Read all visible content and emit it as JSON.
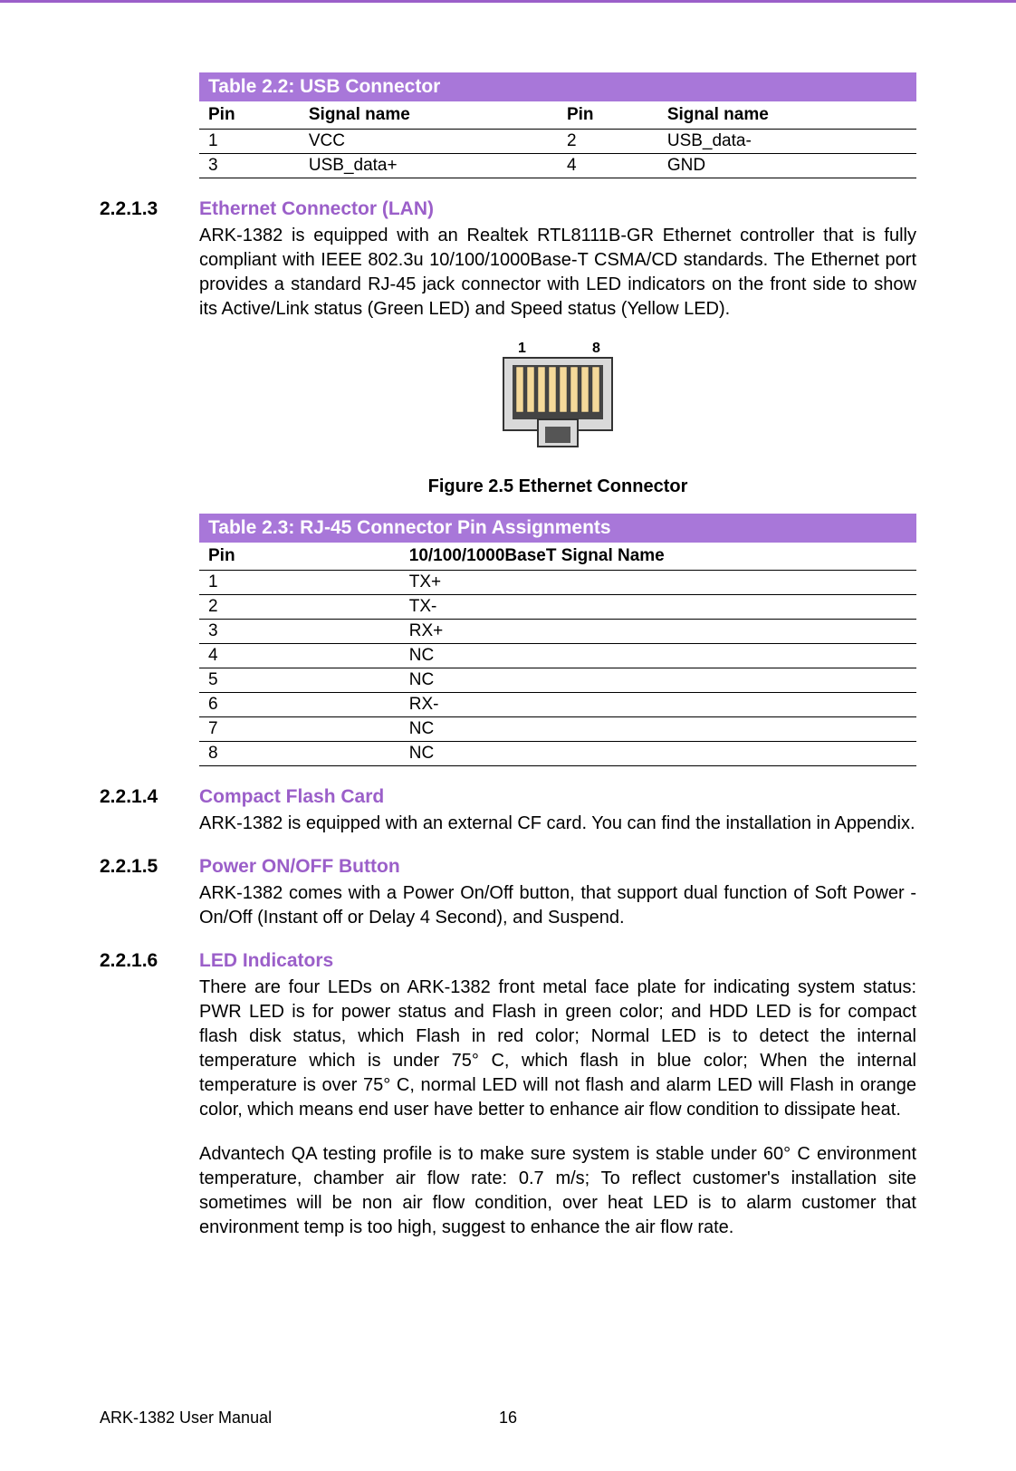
{
  "table22": {
    "title": "Table 2.2: USB Connector",
    "headers": [
      "Pin",
      "Signal name",
      "Pin",
      "Signal name"
    ],
    "rows": [
      [
        "1",
        "VCC",
        "2",
        "USB_data-"
      ],
      [
        "3",
        "USB_data+",
        "4",
        "GND"
      ]
    ]
  },
  "sec2213": {
    "num": "2.2.1.3",
    "title": "Ethernet Connector (LAN)",
    "body": "ARK-1382 is equipped with an Realtek RTL8111B-GR Ethernet controller that is fully compliant with IEEE 802.3u 10/100/1000Base-T CSMA/CD standards. The Ethernet port provides a standard RJ-45 jack connector with LED indicators on the front side to show its Active/Link status (Green LED) and Speed status (Yellow LED)."
  },
  "fig25": {
    "labels": {
      "left": "1",
      "right": "8"
    },
    "caption": "Figure 2.5 Ethernet Connector"
  },
  "table23": {
    "title": "Table 2.3: RJ-45 Connector Pin Assignments",
    "headers": [
      "Pin",
      "10/100/1000BaseT Signal Name"
    ],
    "rows": [
      [
        "1",
        "TX+"
      ],
      [
        "2",
        "TX-"
      ],
      [
        "3",
        "RX+"
      ],
      [
        "4",
        "NC"
      ],
      [
        "5",
        "NC"
      ],
      [
        "6",
        "RX-"
      ],
      [
        "7",
        "NC"
      ],
      [
        "8",
        "NC"
      ]
    ]
  },
  "sec2214": {
    "num": "2.2.1.4",
    "title": "Compact Flash Card",
    "body": "ARK-1382 is equipped with an external CF card. You can find the installation in Appendix."
  },
  "sec2215": {
    "num": "2.2.1.5",
    "title": "Power ON/OFF Button",
    "body": "ARK-1382 comes with a Power On/Off button, that support dual function of Soft Power -On/Off (Instant off or Delay 4 Second), and Suspend."
  },
  "sec2216": {
    "num": "2.2.1.6",
    "title": "LED Indicators",
    "body1": "There are four LEDs on ARK-1382 front metal face plate for indicating system status: PWR LED is for power status and Flash in green color; and HDD LED is for compact flash disk status, which Flash in red color; Normal LED is to detect the internal temperature which is under 75° C, which flash in blue color; When the internal temperature is over 75° C, normal LED will not flash and alarm LED will Flash in orange color, which means end user have better to enhance air flow condition to dissipate heat.",
    "body2": "Advantech QA testing profile is to make sure system is stable under 60° C environment temperature, chamber air flow rate: 0.7 m/s; To reflect customer's installation site sometimes will be non air flow condition, over heat LED is to alarm customer that environment temp is too high, suggest to enhance the air flow rate."
  },
  "footer": {
    "manual": "ARK-1382 User Manual",
    "page": "16"
  }
}
